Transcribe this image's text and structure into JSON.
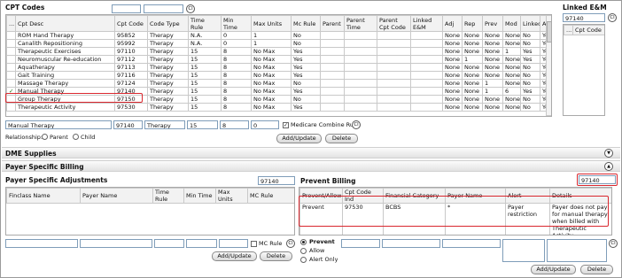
{
  "cpt": {
    "title": "CPT Codes",
    "filter_desc": "",
    "filter_code": "",
    "filter_clear": "Cl",
    "columns": [
      "...",
      "Cpt Desc",
      "Cpt Code",
      "Code Type",
      "Time Rule",
      "Min Time",
      "Max Units",
      "Mc Rule",
      "Parent",
      "Parent Time",
      "Parent Cpt Code",
      "Linked E&M",
      "Adj",
      "Rep",
      "Prev",
      "Mod",
      "Linked",
      "Active"
    ],
    "rows": [
      [
        "",
        "ROM Hand Therapy",
        "95852",
        "Therapy",
        "N.A.",
        "0",
        "1",
        "No",
        "",
        "",
        "",
        "",
        "None",
        "None",
        "None",
        "None",
        "No",
        "Yes"
      ],
      [
        "",
        "Canalith Repositioning",
        "95992",
        "Therapy",
        "N.A.",
        "0",
        "1",
        "No",
        "",
        "",
        "",
        "",
        "None",
        "None",
        "None",
        "None",
        "No",
        "Yes"
      ],
      [
        "",
        "Therapeutic Exercises",
        "97110",
        "Therapy",
        "15",
        "8",
        "No Max",
        "Yes",
        "",
        "",
        "",
        "",
        "None",
        "None",
        "None",
        "1",
        "Yes",
        "Yes"
      ],
      [
        "",
        "Neuromuscular Re-education",
        "97112",
        "Therapy",
        "15",
        "8",
        "No Max",
        "Yes",
        "",
        "",
        "",
        "",
        "None",
        "1",
        "None",
        "None",
        "Yes",
        "Yes"
      ],
      [
        "",
        "Aquatherapy",
        "97113",
        "Therapy",
        "15",
        "8",
        "No Max",
        "Yes",
        "",
        "",
        "",
        "",
        "None",
        "None",
        "None",
        "None",
        "No",
        "Yes"
      ],
      [
        "",
        "Gait Training",
        "97116",
        "Therapy",
        "15",
        "8",
        "No Max",
        "Yes",
        "",
        "",
        "",
        "",
        "None",
        "None",
        "None",
        "None",
        "No",
        "Yes"
      ],
      [
        "",
        "Massage Therapy",
        "97124",
        "Therapy",
        "15",
        "8",
        "No Max",
        "No",
        "",
        "",
        "",
        "",
        "None",
        "None",
        "1",
        "None",
        "No",
        "Yes"
      ],
      [
        "✓",
        "Manual Therapy",
        "97140",
        "Therapy",
        "15",
        "8",
        "No Max",
        "Yes",
        "",
        "",
        "",
        "",
        "None",
        "None",
        "1",
        "6",
        "Yes",
        "Yes"
      ],
      [
        "",
        "Group Therapy",
        "97150",
        "Therapy",
        "15",
        "8",
        "No Max",
        "No",
        "",
        "",
        "",
        "",
        "None",
        "None",
        "None",
        "None",
        "No",
        "Yes"
      ],
      [
        "",
        "Therapeutic Activity",
        "97530",
        "Therapy",
        "15",
        "8",
        "No Max",
        "Yes",
        "",
        "",
        "",
        "",
        "None",
        "None",
        "None",
        "None",
        "No",
        "Yes"
      ]
    ],
    "edit": {
      "desc": "Manual Therapy",
      "code": "97140",
      "type": "Therapy",
      "time_rule": "15",
      "min_time": "8",
      "max_units": "0"
    },
    "medicare_combine_label": "Medicare Combine Rule",
    "medicare_clear": "Cl",
    "add_update": "Add/Update",
    "delete": "Delete",
    "relationship_label": "Relationship:",
    "relationship_options": [
      "Parent",
      "Child"
    ]
  },
  "linked_em": {
    "title": "Linked E&M",
    "filter_value": "97140",
    "filter_clear": "Cl",
    "columns": [
      "...",
      "Cpt Code"
    ]
  },
  "dme": {
    "title": "DME Supplies",
    "toggle": "▼"
  },
  "payer_billing": {
    "title": "Payer Specific Billing",
    "toggle": "▲"
  },
  "payer_adjust": {
    "title": "Payer Specific Adjustments",
    "filter_value": "97140",
    "columns": [
      "Finclass Name",
      "Payer Name",
      "Time Rule",
      "Min Time",
      "Max Units",
      "MC Rule"
    ],
    "mc_rule_label": "MC Rule",
    "clear": "Cl",
    "add_update": "Add/Update",
    "delete": "Delete"
  },
  "prevent": {
    "title": "Prevent Billing",
    "filter_value": "97140",
    "columns": [
      "Prevent/Allow",
      "Cpt Code Ind",
      "Financial Category",
      "Payer Name",
      "Alert",
      "Details"
    ],
    "rows": [
      [
        "Prevent",
        "97530",
        "BCBS",
        "*",
        "Payer restriction",
        "Payer does not pay for manual therapy when billed with Therapeutic Activity"
      ]
    ],
    "options": [
      "Prevent",
      "Allow",
      "Alert Only"
    ],
    "clear": "Cl",
    "add_update": "Add/Update",
    "delete": "Delete"
  }
}
